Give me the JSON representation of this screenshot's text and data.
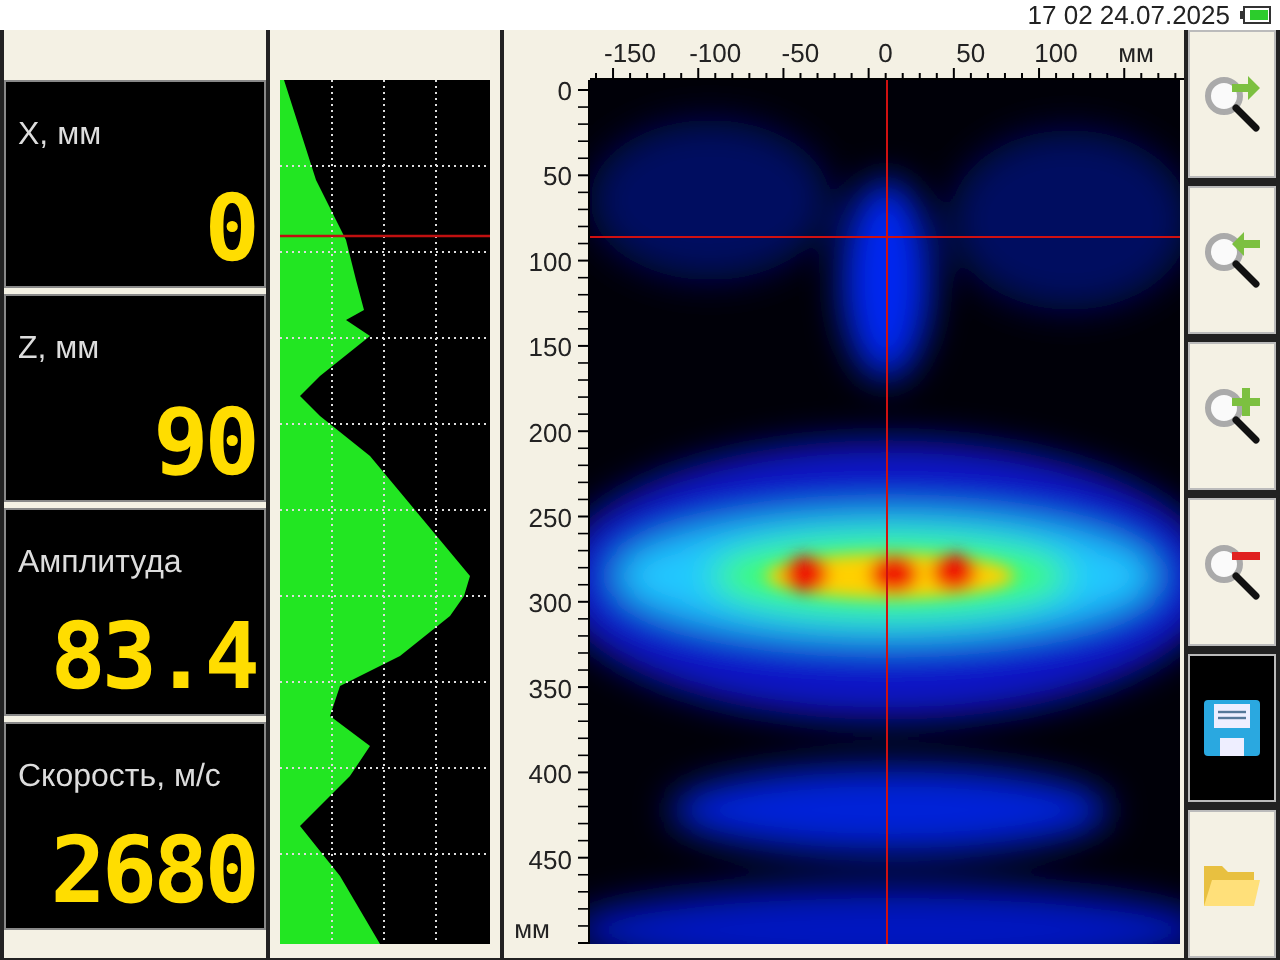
{
  "status_bar": {
    "datetime": "17 02 24.07.2025"
  },
  "readouts": [
    {
      "label": "X, мм",
      "value": "0"
    },
    {
      "label": "Z, мм",
      "value": "90"
    },
    {
      "label": "Амплитуда",
      "value": "83.4"
    },
    {
      "label": "Скорость, м/с",
      "value": "2680"
    }
  ],
  "scan": {
    "x_axis": {
      "ticks": [
        "-150",
        "-100",
        "-50",
        "0",
        "50",
        "100"
      ],
      "unit": "мм"
    },
    "y_axis": {
      "ticks": [
        "0",
        "50",
        "100",
        "150",
        "200",
        "250",
        "300",
        "350",
        "400",
        "450"
      ],
      "unit": "мм"
    }
  },
  "tools": [
    {
      "kind": "zoom-next",
      "selected": false
    },
    {
      "kind": "zoom-prev",
      "selected": false
    },
    {
      "kind": "zoom-in",
      "selected": false
    },
    {
      "kind": "zoom-out",
      "selected": false
    },
    {
      "kind": "save",
      "selected": true
    },
    {
      "kind": "open",
      "selected": false
    }
  ]
}
